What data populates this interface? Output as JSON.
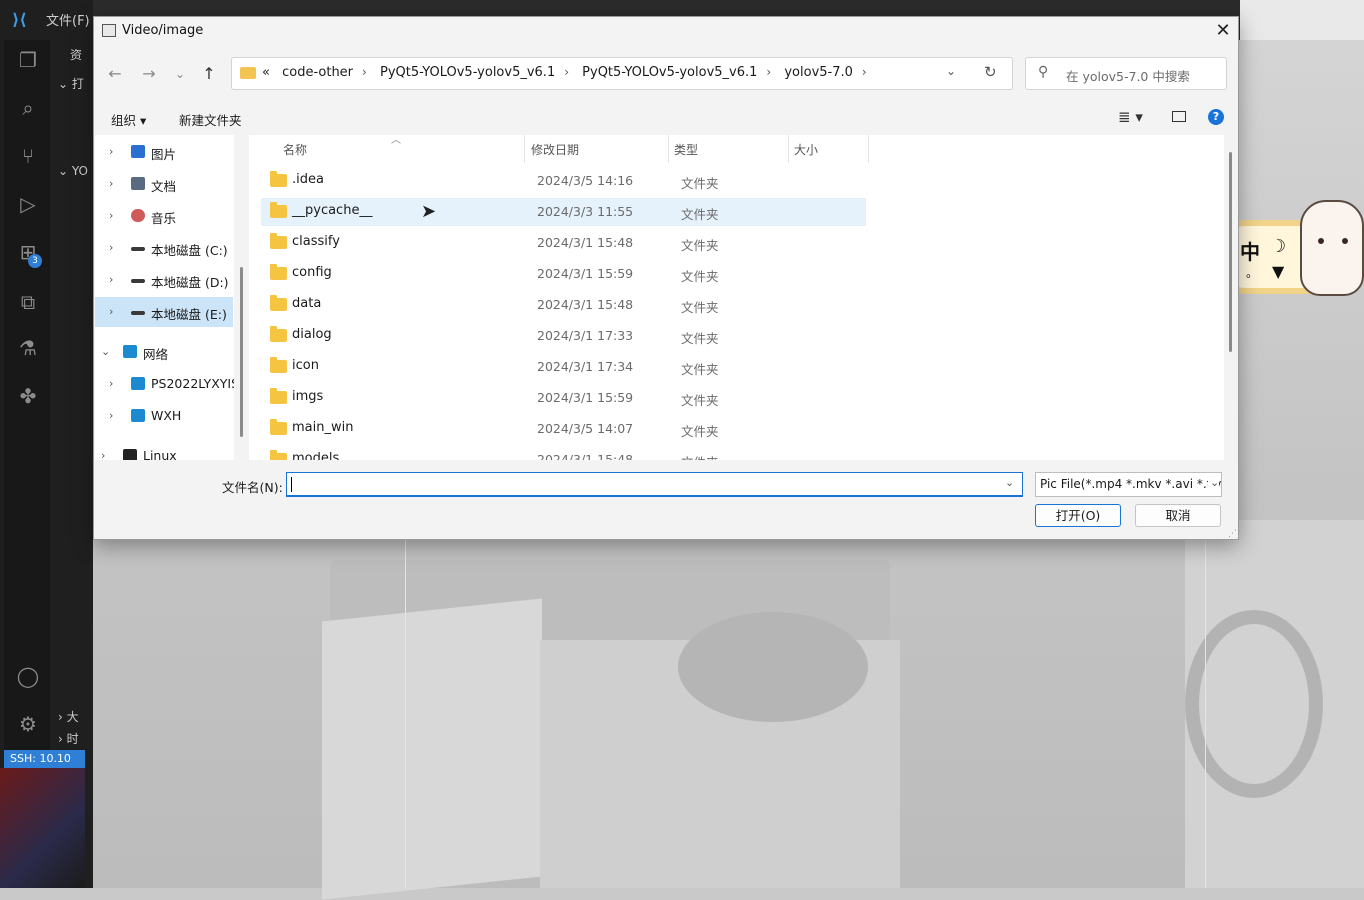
{
  "vscode": {
    "menu": "文件(F)",
    "side_label_1": "资",
    "side_label_2": "打",
    "side_label_3": "YO",
    "side_label_4": "大",
    "side_label_5": "时",
    "extensions_badge": "3",
    "status": "SSH: 10.10"
  },
  "dialog": {
    "title": "Video/image",
    "close": "✕",
    "nav": {
      "back": "←",
      "forward": "→",
      "recent": "⌄",
      "up": "↑"
    },
    "address": {
      "overflow": "«",
      "crumbs": [
        "code-other",
        "PyQt5-YOLOv5-yolov5_v6.1",
        "PyQt5-YOLOv5-yolov5_v6.1",
        "yolov5-7.0"
      ],
      "sep": "›",
      "dropdown": "⌄",
      "refresh": "↻"
    },
    "search": {
      "placeholder": "在 yolov5-7.0 中搜索",
      "icon": "search-icon"
    },
    "toolbar": {
      "organize": "组织 ▾",
      "new_folder": "新建文件夹",
      "view": "≣ ▾",
      "help": "?"
    },
    "nav_pane": [
      {
        "label": "图片",
        "icon": "pictures-icon",
        "color": "#2a6fd1"
      },
      {
        "label": "文档",
        "icon": "documents-icon",
        "color": "#5a6a80"
      },
      {
        "label": "音乐",
        "icon": "music-icon",
        "color": "#d05a5a"
      },
      {
        "label": "本地磁盘 (C:)",
        "icon": "drive-icon",
        "color": "#3a3a3a"
      },
      {
        "label": "本地磁盘 (D:)",
        "icon": "drive-icon",
        "color": "#3a3a3a"
      },
      {
        "label": "本地磁盘 (E:)",
        "icon": "drive-icon",
        "color": "#3a3a3a"
      },
      {
        "label": "网络",
        "icon": "network-icon",
        "color": "#1c8ad1"
      },
      {
        "label": "PS2022LYXYIS",
        "icon": "computer-icon",
        "color": "#1c8ad1"
      },
      {
        "label": "WXH",
        "icon": "computer-icon",
        "color": "#1c8ad1"
      },
      {
        "label": "Linux",
        "icon": "linux-icon",
        "color": "#222222"
      }
    ],
    "columns": {
      "name": "名称",
      "date": "修改日期",
      "type": "类型",
      "size": "大小"
    },
    "files": [
      {
        "name": ".idea",
        "date": "2024/3/5 14:16",
        "type": "文件夹"
      },
      {
        "name": "__pycache__",
        "date": "2024/3/3 11:55",
        "type": "文件夹"
      },
      {
        "name": "classify",
        "date": "2024/3/1 15:48",
        "type": "文件夹"
      },
      {
        "name": "config",
        "date": "2024/3/1 15:59",
        "type": "文件夹"
      },
      {
        "name": "data",
        "date": "2024/3/1 15:48",
        "type": "文件夹"
      },
      {
        "name": "dialog",
        "date": "2024/3/1 17:33",
        "type": "文件夹"
      },
      {
        "name": "icon",
        "date": "2024/3/1 17:34",
        "type": "文件夹"
      },
      {
        "name": "imgs",
        "date": "2024/3/1 15:59",
        "type": "文件夹"
      },
      {
        "name": "main_win",
        "date": "2024/3/5 14:07",
        "type": "文件夹"
      },
      {
        "name": "models",
        "date": "2024/3/1 15:48",
        "type": "文件夹"
      }
    ],
    "filename_label": "文件名(N):",
    "filename_value": "",
    "filetype": "Pic File(*.mp4 *.mkv *.avi *.flv",
    "open_button": "打开(O)",
    "cancel_button": "取消"
  },
  "sticker": {
    "char": "中",
    "moon": "☽",
    "dot": "。",
    "shirt": "👕"
  }
}
